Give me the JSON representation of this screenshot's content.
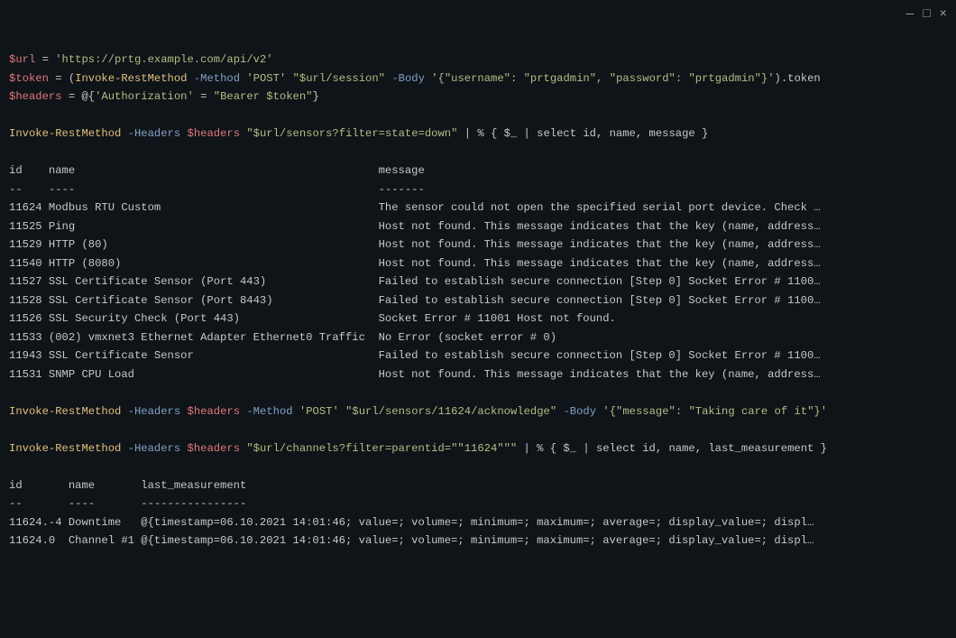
{
  "window": {
    "minimize": "—",
    "maximize": "□",
    "close": "×"
  },
  "code": {
    "line1": {
      "var": "$url",
      "eq": " = ",
      "str": "'https://prtg.example.com/api/v2'"
    },
    "line2": {
      "var1": "$token",
      "eq": " = (",
      "cmd": "Invoke-RestMethod",
      "sp1": " ",
      "flag1": "-Method",
      "sp2": " ",
      "str1": "'POST'",
      "sp3": " ",
      "str2": "\"$url/session\"",
      "sp4": " ",
      "flag2": "-Body",
      "sp5": " ",
      "str3": "'{\"username\": \"prtgadmin\", \"password\": \"prtgadmin\"}'",
      "tail": ").token"
    },
    "line3": {
      "var": "$headers",
      "eq": " = @{",
      "str1": "'Authorization'",
      "mid": " = ",
      "str2": "\"Bearer $token\"",
      "close": "}"
    },
    "line5": {
      "cmd": "Invoke-RestMethod",
      "sp1": " ",
      "flag1": "-Headers",
      "sp2": " ",
      "var": "$headers",
      "sp3": " ",
      "str": "\"$url/sensors?filter=state=down\"",
      "tail": " | % { $_ | select id, name, message }"
    },
    "line_ack": {
      "cmd": "Invoke-RestMethod",
      "sp1": " ",
      "flag1": "-Headers",
      "sp2": " ",
      "var": "$headers",
      "sp3": " ",
      "flag2": "-Method",
      "sp4": " ",
      "str1": "'POST'",
      "sp5": " ",
      "str2": "\"$url/sensors/11624/acknowledge\"",
      "sp6": " ",
      "flag3": "-Body",
      "sp7": " ",
      "str3": "'{\"message\": \"Taking care of it\"}'"
    },
    "line_ch": {
      "cmd": "Invoke-RestMethod",
      "sp1": " ",
      "flag1": "-Headers",
      "sp2": " ",
      "var": "$headers",
      "sp3": " ",
      "str": "\"$url/channels?filter=parentid=\"\"11624\"\"\"",
      "tail": " | % { $_ | select id, name, last_measurement }"
    }
  },
  "table1": {
    "hdr": "id    name                                              message",
    "sep": "--    ----                                              -------",
    "r0": "11624 Modbus RTU Custom                                 The sensor could not open the specified serial port device. Check …",
    "r1": "11525 Ping                                              Host not found. This message indicates that the key (name, address…",
    "r2": "11529 HTTP (80)                                         Host not found. This message indicates that the key (name, address…",
    "r3": "11540 HTTP (8080)                                       Host not found. This message indicates that the key (name, address…",
    "r4": "11527 SSL Certificate Sensor (Port 443)                 Failed to establish secure connection [Step 0] Socket Error # 1100…",
    "r5": "11528 SSL Certificate Sensor (Port 8443)                Failed to establish secure connection [Step 0] Socket Error # 1100…",
    "r6": "11526 SSL Security Check (Port 443)                     Socket Error # 11001 Host not found.",
    "r7": "11533 (002) vmxnet3 Ethernet Adapter Ethernet0 Traffic  No Error (socket error # 0)",
    "r8": "11943 SSL Certificate Sensor                            Failed to establish secure connection [Step 0] Socket Error # 1100…",
    "r9": "11531 SNMP CPU Load                                     Host not found. This message indicates that the key (name, address…"
  },
  "table2": {
    "hdr": "id       name       last_measurement",
    "sep": "--       ----       ----------------",
    "r0": "11624.-4 Downtime   @{timestamp=06.10.2021 14:01:46; value=; volume=; minimum=; maximum=; average=; display_value=; displ…",
    "r1": "11624.0  Channel #1 @{timestamp=06.10.2021 14:01:46; value=; volume=; minimum=; maximum=; average=; display_value=; displ…"
  }
}
